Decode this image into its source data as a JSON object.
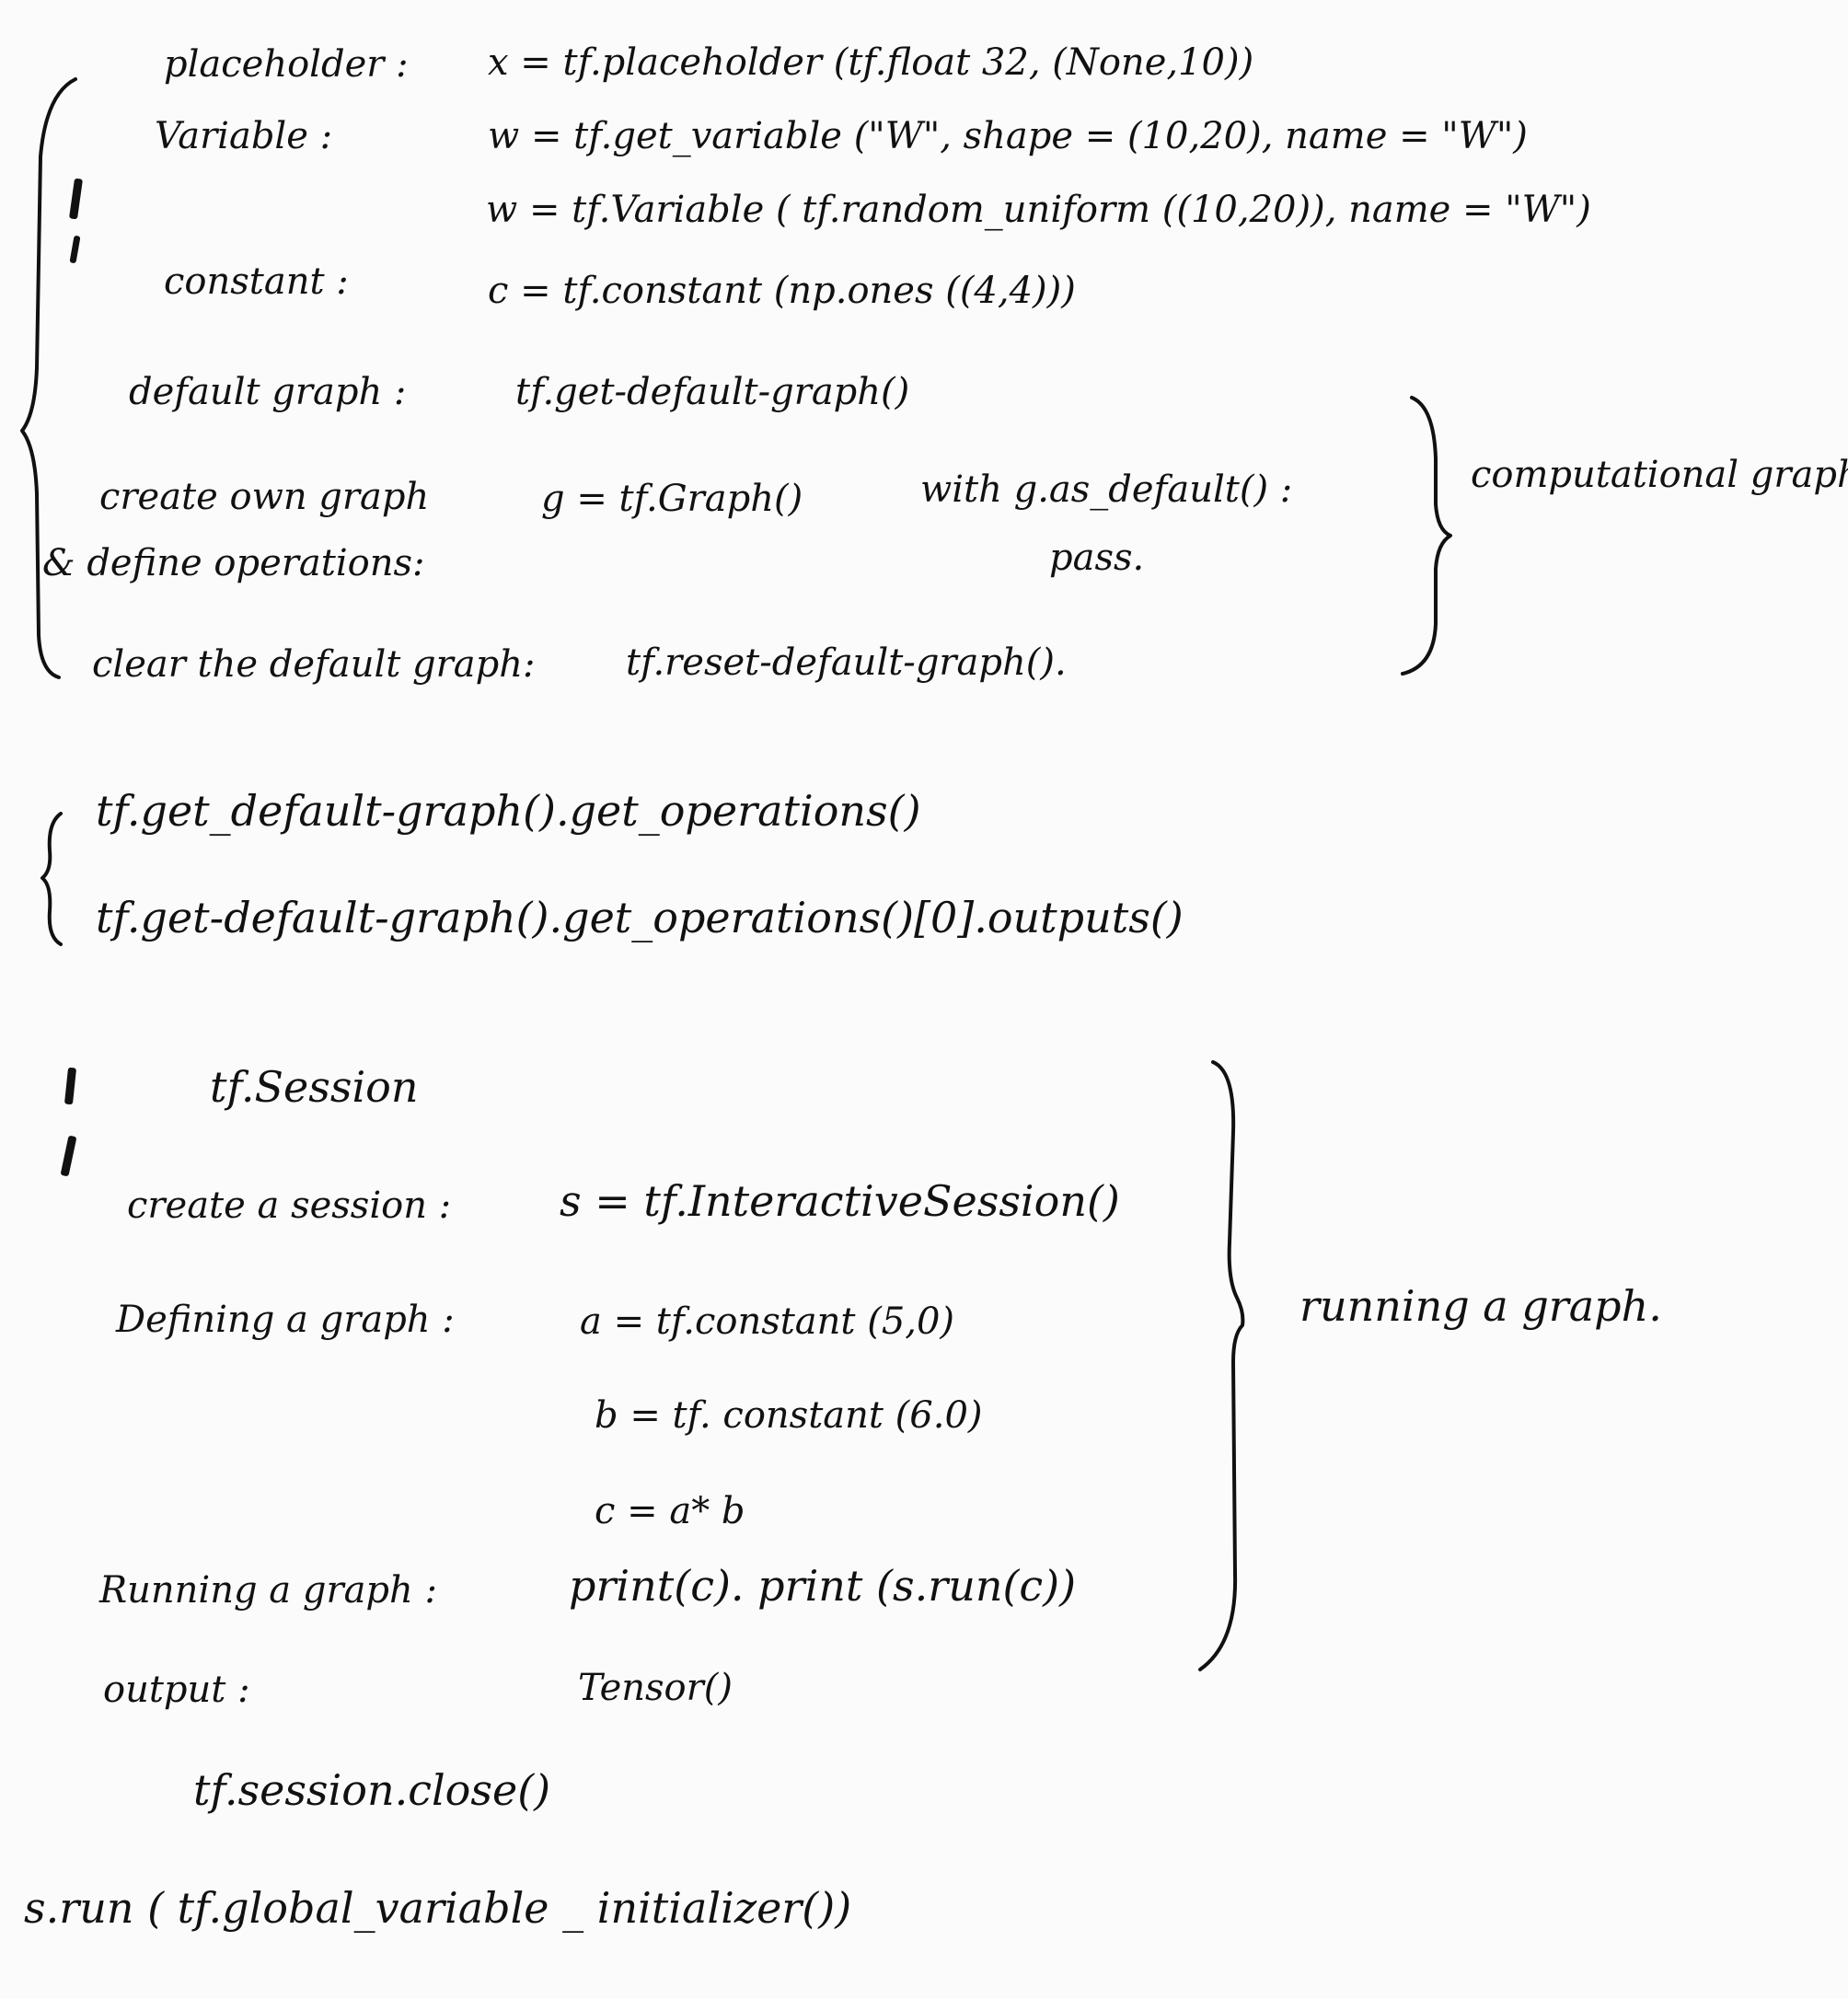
{
  "graph_section": {
    "placeholder_label": "placeholder :",
    "placeholder_code": "x = tf.placeholder (tf.float 32, (None,10))",
    "variable_label": "Variable :",
    "variable_code_1": "w = tf.get_variable (\"W\", shape = (10,20), name = \"W\")",
    "variable_code_2": "w = tf.Variable ( tf.random_uniform ((10,20)), name = \"W\")",
    "constant_label": "constant :",
    "constant_code": "c = tf.constant (np.ones ((4,4)))",
    "default_graph_label": "default graph :",
    "default_graph_code": "tf.get-default-graph()",
    "create_graph_label": "create own graph",
    "define_ops_label": "& define operations:",
    "create_graph_code": "g = tf.Graph()",
    "with_code": "with g.as_default() :",
    "pass_code": "pass.",
    "clear_label": "clear the default graph:",
    "clear_code": "tf.reset-default-graph().",
    "brace_caption": "computational graph"
  },
  "ops_section": {
    "line_1": "tf.get_default-graph().get_operations()",
    "line_2": "tf.get-default-graph().get_operations()[0].outputs()"
  },
  "session_section": {
    "title": "tf.Session",
    "create_label": "create a session :",
    "create_code": "s = tf.InteractiveSession()",
    "define_label": "Defining a graph :",
    "define_code_1": "a = tf.constant (5,0)",
    "define_code_2": "b = tf. constant (6.0)",
    "define_code_3": "c = a* b",
    "run_label": "Running a graph :",
    "run_code": "print(c). print (s.run(c))",
    "output_label": "output :",
    "output_code": "Tensor()",
    "close_code": "tf.session.close()",
    "brace_caption": "running a graph."
  },
  "footer_line": "s.run ( tf.global_variable _ initializer())"
}
